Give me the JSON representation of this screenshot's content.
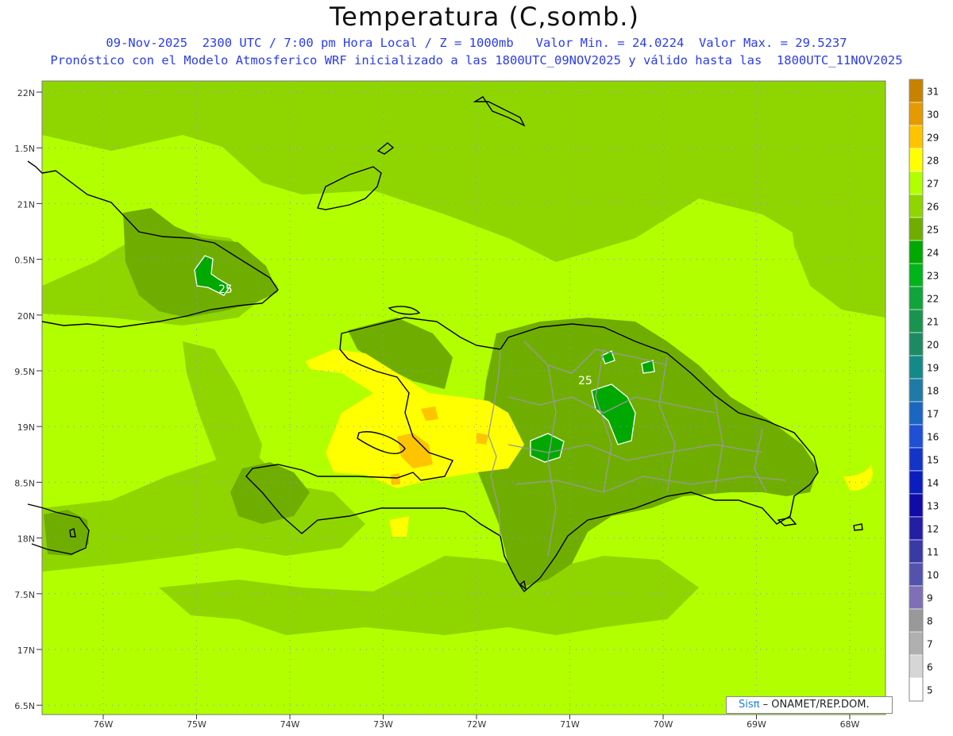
{
  "title": "Temperatura (C,somb.)",
  "subtitle_line1": "09-Nov-2025  2300 UTC / 7:00 pm Hora Local / Z = 1000mb   Valor Min. = 24.0224  Valor Max. = 29.5237",
  "subtitle_line2": "Pronóstico con el Modelo Atmosferico WRF inicializado a las 1800UTC_09NOV2025 y válido hasta las  1800UTC_11NOV2025",
  "lat_labels": [
    "22N",
    "1.5N",
    "21N",
    "0.5N",
    "20N",
    "9.5N",
    "19N",
    "8.5N",
    "18N",
    "7.5N",
    "17N",
    "6.5N"
  ],
  "lon_labels": [
    "76W",
    "75W",
    "74W",
    "73W",
    "72W",
    "71W",
    "70W",
    "69W",
    "68W"
  ],
  "colorbar": {
    "labels": [
      "31",
      "30",
      "29",
      "28",
      "27",
      "26",
      "25",
      "24",
      "23",
      "22",
      "21",
      "20",
      "19",
      "18",
      "17",
      "16",
      "15",
      "14",
      "13",
      "12",
      "11",
      "10",
      "9",
      "8",
      "7",
      "6",
      "5"
    ],
    "colors": [
      "#c98200",
      "#e49a00",
      "#ffc400",
      "#ffff00",
      "#b2ff00",
      "#8fd600",
      "#6fae00",
      "#00a800",
      "#00b419",
      "#10a43c",
      "#19944f",
      "#1d8a64",
      "#148a88",
      "#1f7aa8",
      "#1a66c0",
      "#1e4fd4",
      "#1234c8",
      "#0a1ec0",
      "#0f0aa8",
      "#231ea4",
      "#3a3aa6",
      "#5353ad",
      "#7f6fb5",
      "#999999",
      "#b0b0b0",
      "#d6d6d6",
      "#ffffff"
    ]
  },
  "contour_labels": [
    "25",
    "25"
  ],
  "credit_logo": "Sisπ",
  "credit_text": "ONAMET/REP.DOM.",
  "field_colors": {
    "base": "#b2ff00",
    "band26": "#8fd600",
    "band25": "#6fae00",
    "band28": "#ffff00",
    "band29": "#ffc400",
    "band24": "#00a800"
  }
}
